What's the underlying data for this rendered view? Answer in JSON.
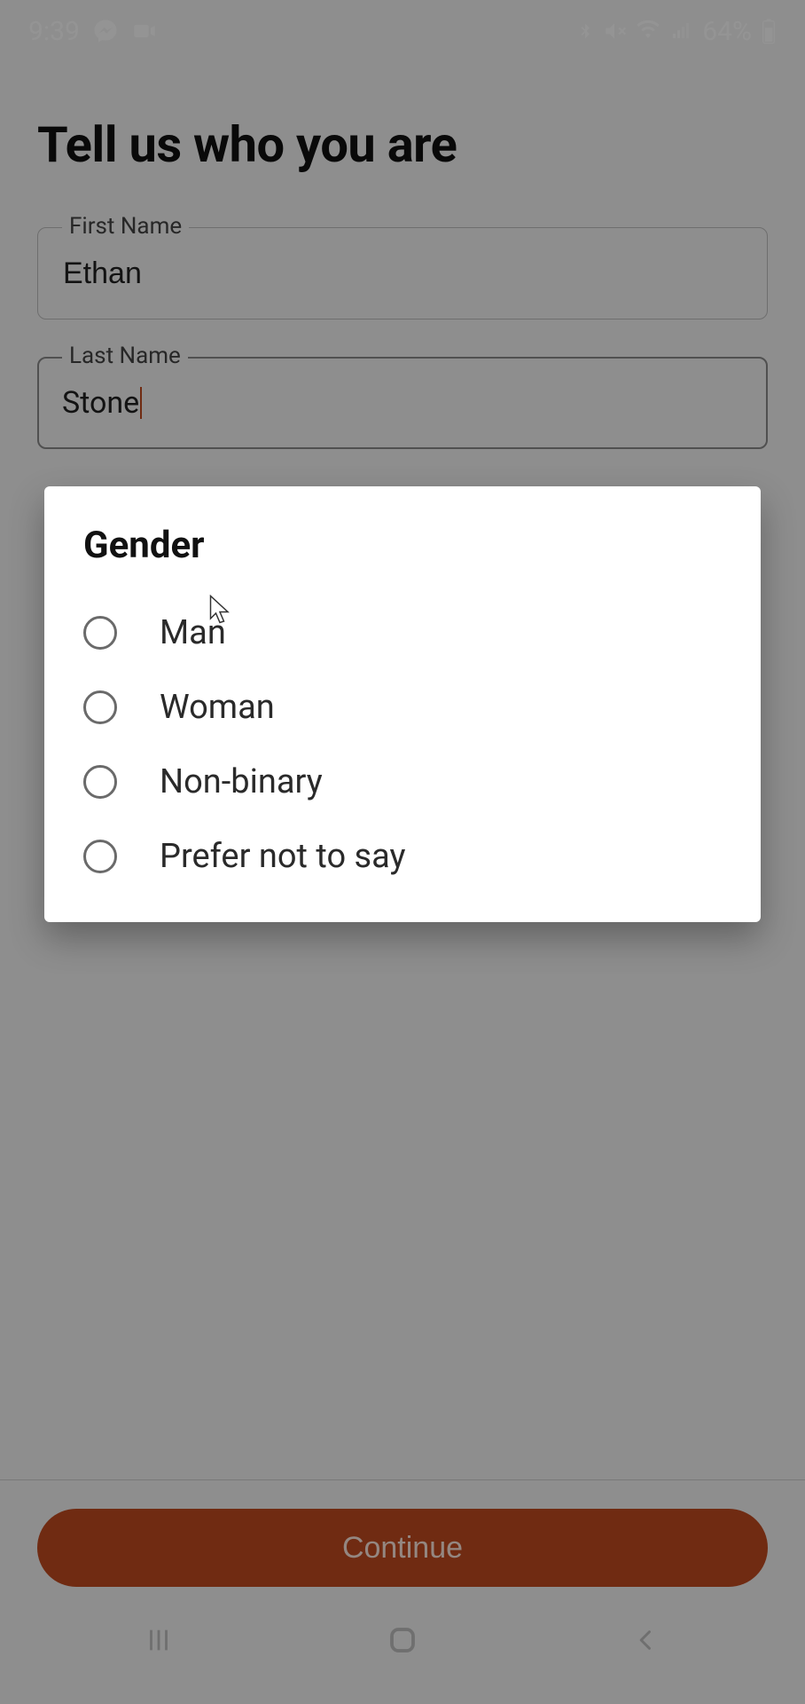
{
  "status_bar": {
    "time": "9:39",
    "battery": "64%"
  },
  "page": {
    "title": "Tell us who you are"
  },
  "fields": {
    "first_name": {
      "label": "First Name",
      "value": "Ethan"
    },
    "last_name": {
      "label": "Last Name",
      "value": "Stone"
    }
  },
  "dialog": {
    "title": "Gender",
    "options": [
      "Man",
      "Woman",
      "Non-binary",
      "Prefer not to say"
    ]
  },
  "actions": {
    "continue": "Continue"
  },
  "colors": {
    "accent": "#c14a20"
  }
}
